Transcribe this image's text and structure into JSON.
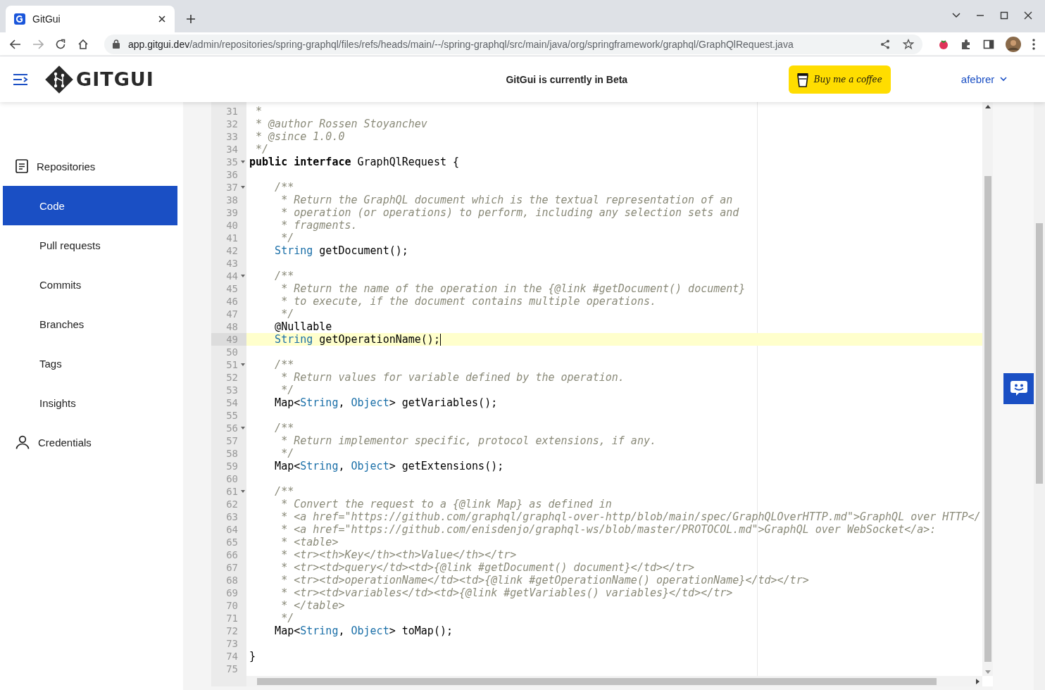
{
  "browser": {
    "tab": {
      "title": "GitGui",
      "selected": true
    },
    "url_host": "app.gitgui.dev",
    "url_path": "/admin/repositories/spring-graphql/files/refs/heads/main/--/spring-graphql/src/main/java/org/springframework/graphql/GraphQlRequest.java"
  },
  "header": {
    "logo": "GITGUI",
    "notice": "GitGui is currently in Beta",
    "coffee_button": "Buy me a coffee",
    "user": "afebrer"
  },
  "sidebar": {
    "items": [
      {
        "label": "Repositories",
        "kind": "section",
        "selected": false
      },
      {
        "label": "Code",
        "kind": "sub",
        "selected": true
      },
      {
        "label": "Pull requests",
        "kind": "sub",
        "selected": false
      },
      {
        "label": "Commits",
        "kind": "sub",
        "selected": false
      },
      {
        "label": "Branches",
        "kind": "sub",
        "selected": false
      },
      {
        "label": "Tags",
        "kind": "sub",
        "selected": false
      },
      {
        "label": "Insights",
        "kind": "sub",
        "selected": false
      },
      {
        "label": "Credentials",
        "kind": "account",
        "selected": false
      }
    ]
  },
  "editor": {
    "lines": [
      {
        "number": "31",
        "fold": false,
        "active": false,
        "tokens": [
          {
            "kind": "comment",
            "text": " *"
          }
        ]
      },
      {
        "number": "32",
        "fold": false,
        "active": false,
        "tokens": [
          {
            "kind": "comment",
            "text": " * @author Rossen Stoyanchev"
          }
        ]
      },
      {
        "number": "33",
        "fold": false,
        "active": false,
        "tokens": [
          {
            "kind": "comment",
            "text": " * @since 1.0.0"
          }
        ]
      },
      {
        "number": "34",
        "fold": false,
        "active": false,
        "tokens": [
          {
            "kind": "comment",
            "text": " */"
          }
        ]
      },
      {
        "number": "35",
        "fold": true,
        "active": false,
        "tokens": [
          {
            "kind": "keyword",
            "text": "public interface"
          },
          {
            "kind": "plain",
            "text": " GraphQlRequest {"
          }
        ]
      },
      {
        "number": "36",
        "fold": false,
        "active": false
      },
      {
        "number": "37",
        "fold": true,
        "active": false,
        "tokens": [
          {
            "kind": "comment",
            "text": "    /**"
          }
        ]
      },
      {
        "number": "38",
        "fold": false,
        "active": false,
        "tokens": [
          {
            "kind": "comment",
            "text": "     * Return the GraphQL document which is the textual representation of an"
          }
        ]
      },
      {
        "number": "39",
        "fold": false,
        "active": false,
        "tokens": [
          {
            "kind": "comment",
            "text": "     * operation (or operations) to perform, including any selection sets and"
          }
        ]
      },
      {
        "number": "40",
        "fold": false,
        "active": false,
        "tokens": [
          {
            "kind": "comment",
            "text": "     * fragments."
          }
        ]
      },
      {
        "number": "41",
        "fold": false,
        "active": false,
        "tokens": [
          {
            "kind": "comment",
            "text": "     */"
          }
        ]
      },
      {
        "number": "42",
        "fold": false,
        "active": false,
        "tokens": [
          {
            "kind": "type",
            "text": "    String"
          },
          {
            "kind": "plain",
            "text": " getDocument();"
          }
        ]
      },
      {
        "number": "43",
        "fold": false,
        "active": false
      },
      {
        "number": "44",
        "fold": true,
        "active": false,
        "tokens": [
          {
            "kind": "comment",
            "text": "    /**"
          }
        ]
      },
      {
        "number": "45",
        "fold": false,
        "active": false,
        "tokens": [
          {
            "kind": "comment",
            "text": "     * Return the name of the operation in the {@link #getDocument() document}"
          }
        ]
      },
      {
        "number": "46",
        "fold": false,
        "active": false,
        "tokens": [
          {
            "kind": "comment",
            "text": "     * to execute, if the document contains multiple operations."
          }
        ]
      },
      {
        "number": "47",
        "fold": false,
        "active": false,
        "tokens": [
          {
            "kind": "comment",
            "text": "     */"
          }
        ]
      },
      {
        "number": "48",
        "fold": false,
        "active": false,
        "tokens": [
          {
            "kind": "plain",
            "text": "    @Nullable"
          }
        ]
      },
      {
        "number": "49",
        "fold": false,
        "active": true,
        "tokens": [
          {
            "kind": "type",
            "text": "    String"
          },
          {
            "kind": "plain",
            "text": " getOperationName();"
          }
        ]
      },
      {
        "number": "50",
        "fold": false,
        "active": false
      },
      {
        "number": "51",
        "fold": true,
        "active": false,
        "tokens": [
          {
            "kind": "comment",
            "text": "    /**"
          }
        ]
      },
      {
        "number": "52",
        "fold": false,
        "active": false,
        "tokens": [
          {
            "kind": "comment",
            "text": "     * Return values for variable defined by the operation."
          }
        ]
      },
      {
        "number": "53",
        "fold": false,
        "active": false,
        "tokens": [
          {
            "kind": "comment",
            "text": "     */"
          }
        ]
      },
      {
        "number": "54",
        "fold": false,
        "active": false,
        "tokens": [
          {
            "kind": "plain",
            "text": "    Map<"
          },
          {
            "kind": "type",
            "text": "String"
          },
          {
            "kind": "plain",
            "text": ", "
          },
          {
            "kind": "type",
            "text": "Object"
          },
          {
            "kind": "plain",
            "text": "> getVariables();"
          }
        ]
      },
      {
        "number": "55",
        "fold": false,
        "active": false
      },
      {
        "number": "56",
        "fold": true,
        "active": false,
        "tokens": [
          {
            "kind": "comment",
            "text": "    /**"
          }
        ]
      },
      {
        "number": "57",
        "fold": false,
        "active": false,
        "tokens": [
          {
            "kind": "comment",
            "text": "     * Return implementor specific, protocol extensions, if any."
          }
        ]
      },
      {
        "number": "58",
        "fold": false,
        "active": false,
        "tokens": [
          {
            "kind": "comment",
            "text": "     */"
          }
        ]
      },
      {
        "number": "59",
        "fold": false,
        "active": false,
        "tokens": [
          {
            "kind": "plain",
            "text": "    Map<"
          },
          {
            "kind": "type",
            "text": "String"
          },
          {
            "kind": "plain",
            "text": ", "
          },
          {
            "kind": "type",
            "text": "Object"
          },
          {
            "kind": "plain",
            "text": "> getExtensions();"
          }
        ]
      },
      {
        "number": "60",
        "fold": false,
        "active": false
      },
      {
        "number": "61",
        "fold": true,
        "active": false,
        "tokens": [
          {
            "kind": "comment",
            "text": "    /**"
          }
        ]
      },
      {
        "number": "62",
        "fold": false,
        "active": false,
        "tokens": [
          {
            "kind": "comment",
            "text": "     * Convert the request to a {@link Map} as defined in"
          }
        ]
      },
      {
        "number": "63",
        "fold": false,
        "active": false,
        "tokens": [
          {
            "kind": "comment",
            "text": "     * <a href=\"https://github.com/graphql/graphql-over-http/blob/main/spec/GraphQLOverHTTP.md\">GraphQL over HTTP</"
          }
        ]
      },
      {
        "number": "64",
        "fold": false,
        "active": false,
        "tokens": [
          {
            "kind": "comment",
            "text": "     * <a href=\"https://github.com/enisdenjo/graphql-ws/blob/master/PROTOCOL.md\">GraphQL over WebSocket</a>:"
          }
        ]
      },
      {
        "number": "65",
        "fold": false,
        "active": false,
        "tokens": [
          {
            "kind": "comment",
            "text": "     * <table>"
          }
        ]
      },
      {
        "number": "66",
        "fold": false,
        "active": false,
        "tokens": [
          {
            "kind": "comment",
            "text": "     * <tr><th>Key</th><th>Value</th></tr>"
          }
        ]
      },
      {
        "number": "67",
        "fold": false,
        "active": false,
        "tokens": [
          {
            "kind": "comment",
            "text": "     * <tr><td>query</td><td>{@link #getDocument() document}</td></tr>"
          }
        ]
      },
      {
        "number": "68",
        "fold": false,
        "active": false,
        "tokens": [
          {
            "kind": "comment",
            "text": "     * <tr><td>operationName</td><td>{@link #getOperationName() operationName}</td></tr>"
          }
        ]
      },
      {
        "number": "69",
        "fold": false,
        "active": false,
        "tokens": [
          {
            "kind": "comment",
            "text": "     * <tr><td>variables</td><td>{@link #getVariables() variables}</td></tr>"
          }
        ]
      },
      {
        "number": "70",
        "fold": false,
        "active": false,
        "tokens": [
          {
            "kind": "comment",
            "text": "     * </table>"
          }
        ]
      },
      {
        "number": "71",
        "fold": false,
        "active": false,
        "tokens": [
          {
            "kind": "comment",
            "text": "     */"
          }
        ]
      },
      {
        "number": "72",
        "fold": false,
        "active": false,
        "tokens": [
          {
            "kind": "plain",
            "text": "    Map<"
          },
          {
            "kind": "type",
            "text": "String"
          },
          {
            "kind": "plain",
            "text": ", "
          },
          {
            "kind": "type",
            "text": "Object"
          },
          {
            "kind": "plain",
            "text": "> toMap();"
          }
        ]
      },
      {
        "number": "73",
        "fold": false,
        "active": false
      },
      {
        "number": "74",
        "fold": false,
        "active": false,
        "tokens": [
          {
            "kind": "plain",
            "text": "}"
          }
        ]
      },
      {
        "number": "75",
        "fold": false,
        "active": false
      }
    ]
  }
}
